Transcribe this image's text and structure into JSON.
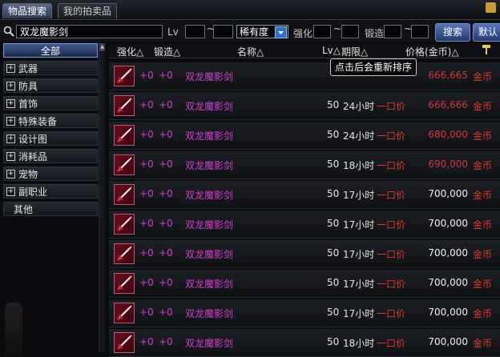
{
  "tabs": [
    {
      "label": "物品搜索",
      "active": true
    },
    {
      "label": "我的拍卖品",
      "active": false
    }
  ],
  "search": {
    "query": "双龙魔影剑",
    "lv_label": "Lv",
    "tilde": "~",
    "rarity_value": "稀有度",
    "enhance_label": "强化",
    "forge_label": "锻造",
    "search_button": "搜索",
    "default_button": "默认"
  },
  "categories": [
    {
      "label": "全部",
      "selected": true,
      "expandable": false
    },
    {
      "label": "武器",
      "selected": false,
      "expandable": true
    },
    {
      "label": "防具",
      "selected": false,
      "expandable": true
    },
    {
      "label": "首饰",
      "selected": false,
      "expandable": true
    },
    {
      "label": "特殊装备",
      "selected": false,
      "expandable": true
    },
    {
      "label": "设计图",
      "selected": false,
      "expandable": true
    },
    {
      "label": "消耗品",
      "selected": false,
      "expandable": true
    },
    {
      "label": "宠物",
      "selected": false,
      "expandable": true
    },
    {
      "label": "副职业",
      "selected": false,
      "expandable": true
    },
    {
      "label": "其他",
      "selected": false,
      "expandable": false
    }
  ],
  "columns": {
    "enhance": "强化△",
    "forge": "锻造△",
    "name": "名称△",
    "lv": "Lv△",
    "period": "期限△",
    "price": "价格(金币)△"
  },
  "tooltip": "点击后会重新排序",
  "rows": [
    {
      "enhance": "+0",
      "forge": "+0",
      "name": "双龙魔影剑",
      "lv": "",
      "period": "",
      "type": "",
      "price": "666,665",
      "currency": "金币",
      "price_red": true
    },
    {
      "enhance": "+0",
      "forge": "+0",
      "name": "双龙魔影剑",
      "lv": "50",
      "period": "24小时",
      "type": "一口价",
      "price": "666,666",
      "currency": "金币",
      "price_red": true
    },
    {
      "enhance": "+0",
      "forge": "+0",
      "name": "双龙魔影剑",
      "lv": "50",
      "period": "24小时",
      "type": "一口价",
      "price": "680,000",
      "currency": "金币",
      "price_red": true
    },
    {
      "enhance": "+0",
      "forge": "+0",
      "name": "双龙魔影剑",
      "lv": "50",
      "period": "18小时",
      "type": "一口价",
      "price": "690,000",
      "currency": "金币",
      "price_red": true
    },
    {
      "enhance": "+0",
      "forge": "+0",
      "name": "双龙魔影剑",
      "lv": "50",
      "period": "17小时",
      "type": "一口价",
      "price": "700,000",
      "currency": "金币",
      "price_red": false
    },
    {
      "enhance": "+0",
      "forge": "+0",
      "name": "双龙魔影剑",
      "lv": "50",
      "period": "17小时",
      "type": "一口价",
      "price": "700,000",
      "currency": "金币",
      "price_red": false
    },
    {
      "enhance": "+0",
      "forge": "+0",
      "name": "双龙魔影剑",
      "lv": "50",
      "period": "17小时",
      "type": "一口价",
      "price": "700,000",
      "currency": "金币",
      "price_red": false
    },
    {
      "enhance": "+0",
      "forge": "+0",
      "name": "双龙魔影剑",
      "lv": "50",
      "period": "17小时",
      "type": "一口价",
      "price": "700,000",
      "currency": "金币",
      "price_red": false
    },
    {
      "enhance": "+0",
      "forge": "+0",
      "name": "双龙魔影剑",
      "lv": "50",
      "period": "17小时",
      "type": "一口价",
      "price": "700,000",
      "currency": "金币",
      "price_red": false
    },
    {
      "enhance": "+0",
      "forge": "+0",
      "name": "双龙魔影剑",
      "lv": "50",
      "period": "18小时",
      "type": "一口价",
      "price": "700,000",
      "currency": "金币",
      "price_red": false
    }
  ],
  "colors": {
    "name_pink": "#d040d0",
    "price_red": "#d03a3a",
    "currency_red": "#e03a2a",
    "tab_active": "#3d5a8c"
  },
  "icons": {
    "item": "sword-icon",
    "sort_hammer": "hammer-icon",
    "search": "search-icon"
  }
}
